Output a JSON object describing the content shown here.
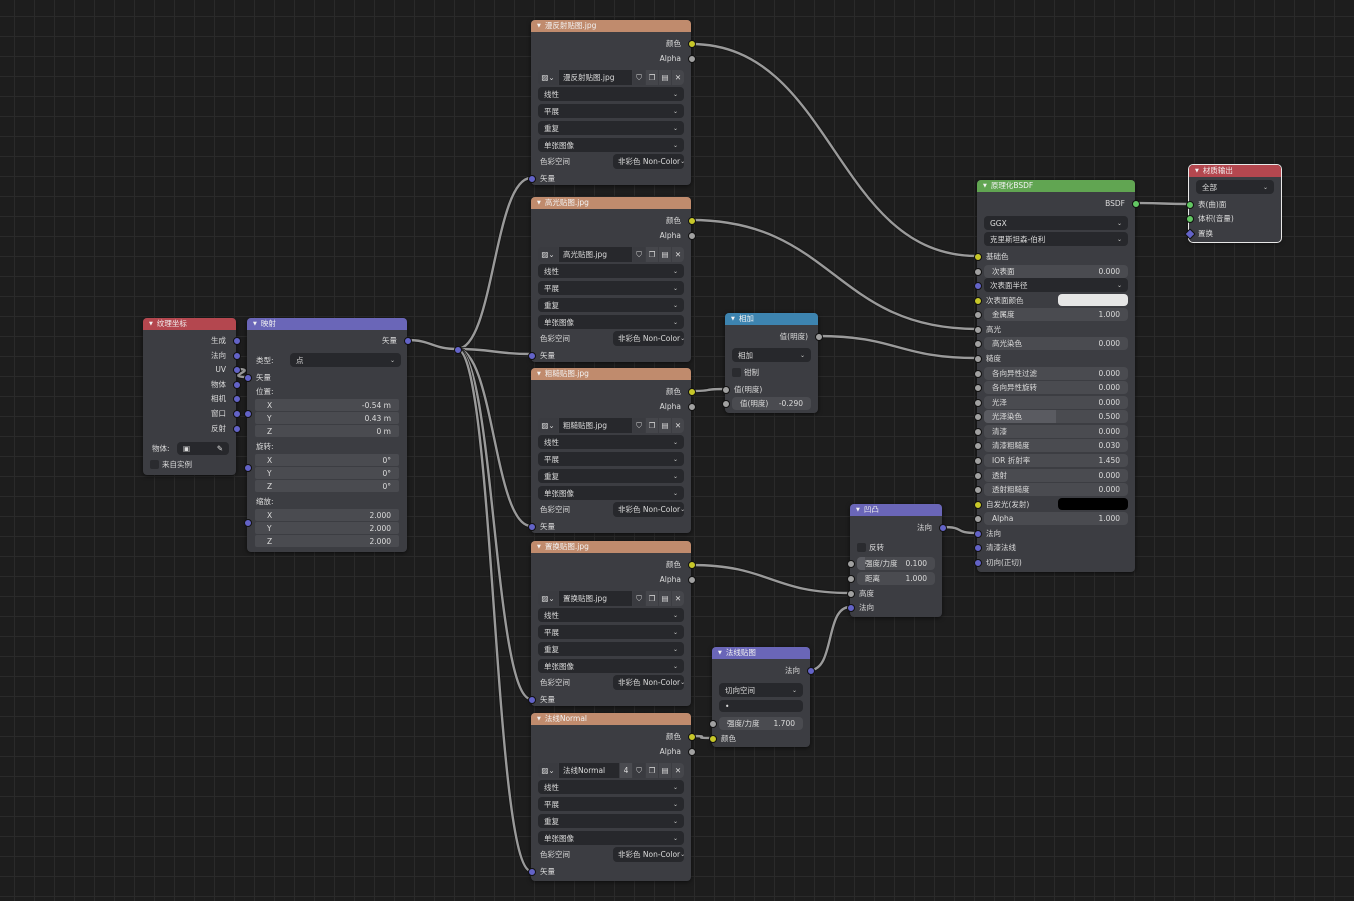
{
  "colors": {
    "socket_gray": "#a1a1a1",
    "socket_yellow": "#c7c729",
    "socket_blue": "#6363c7",
    "socket_green": "#63c763",
    "header_image": "#c08b6d",
    "header_input": "#b4474f",
    "header_vector": "#6a66b8",
    "header_converter": "#3d84b0",
    "header_shader": "#61a552",
    "header_output": "#b4474f",
    "wire": "#9a9a9a"
  },
  "nodes": {
    "texcoord": {
      "title": "纹理坐标",
      "rows": [
        {
          "k": "out",
          "label": "生成",
          "s": "blue"
        },
        {
          "k": "out",
          "label": "法向",
          "s": "blue"
        },
        {
          "k": "out",
          "label": "UV",
          "s": "blue"
        },
        {
          "k": "out",
          "label": "物体",
          "s": "blue"
        },
        {
          "k": "out",
          "label": "相机",
          "s": "blue"
        },
        {
          "k": "out",
          "label": "窗口",
          "s": "blue"
        },
        {
          "k": "out",
          "label": "反射",
          "s": "blue"
        },
        {
          "k": "object",
          "label": "物体:",
          "icon": "object-icon"
        },
        {
          "k": "check",
          "label": "来自实例",
          "checked": false
        }
      ]
    },
    "mapping": {
      "title": "映射",
      "rows": [
        {
          "k": "out",
          "label": "矢量",
          "s": "blue"
        },
        {
          "k": "prop",
          "label": "类型:",
          "value": "点"
        },
        {
          "k": "in",
          "label": "矢量",
          "s": "blue"
        },
        {
          "k": "lbl",
          "label": "位置:"
        },
        {
          "k": "vec",
          "label": "X",
          "value": "-0.54 m"
        },
        {
          "k": "vec",
          "label": "Y",
          "value": "0.43 m"
        },
        {
          "k": "vec",
          "label": "Z",
          "value": "0 m"
        },
        {
          "k": "lbl",
          "label": "旋转:"
        },
        {
          "k": "vec",
          "label": "X",
          "value": "0°"
        },
        {
          "k": "vec",
          "label": "Y",
          "value": "0°"
        },
        {
          "k": "vec",
          "label": "Z",
          "value": "0°"
        },
        {
          "k": "lbl",
          "label": "缩放:"
        },
        {
          "k": "vec",
          "label": "X",
          "value": "2.000"
        },
        {
          "k": "vec",
          "label": "Y",
          "value": "2.000"
        },
        {
          "k": "vec",
          "label": "Z",
          "value": "2.000"
        }
      ]
    },
    "img_diffuse": {
      "title": "漫反射贴图.jpg",
      "rows": [
        {
          "k": "out",
          "label": "颜色",
          "s": "yellow"
        },
        {
          "k": "out",
          "label": "Alpha",
          "s": "gray"
        },
        {
          "k": "img",
          "value": "漫反射贴图.jpg"
        },
        {
          "k": "dd",
          "value": "线性"
        },
        {
          "k": "dd",
          "value": "平展"
        },
        {
          "k": "dd",
          "value": "重复"
        },
        {
          "k": "dd",
          "value": "单张图像"
        },
        {
          "k": "cs",
          "label": "色彩空间",
          "value": "非彩色 Non-Color"
        },
        {
          "k": "in",
          "label": "矢量",
          "s": "blue"
        }
      ]
    },
    "img_specular": {
      "title": "高光贴图.jpg",
      "rows": [
        {
          "k": "out",
          "label": "颜色",
          "s": "yellow"
        },
        {
          "k": "out",
          "label": "Alpha",
          "s": "gray"
        },
        {
          "k": "img",
          "value": "高光贴图.jpg"
        },
        {
          "k": "dd",
          "value": "线性"
        },
        {
          "k": "dd",
          "value": "平展"
        },
        {
          "k": "dd",
          "value": "重复"
        },
        {
          "k": "dd",
          "value": "单张图像"
        },
        {
          "k": "cs",
          "label": "色彩空间",
          "value": "非彩色 Non-Color"
        },
        {
          "k": "in",
          "label": "矢量",
          "s": "blue"
        }
      ]
    },
    "img_roughness": {
      "title": "粗糙贴图.jpg",
      "rows": [
        {
          "k": "out",
          "label": "颜色",
          "s": "yellow"
        },
        {
          "k": "out",
          "label": "Alpha",
          "s": "gray"
        },
        {
          "k": "img",
          "value": "粗糙贴图.jpg"
        },
        {
          "k": "dd",
          "value": "线性"
        },
        {
          "k": "dd",
          "value": "平展"
        },
        {
          "k": "dd",
          "value": "重复"
        },
        {
          "k": "dd",
          "value": "单张图像"
        },
        {
          "k": "cs",
          "label": "色彩空间",
          "value": "非彩色 Non-Color"
        },
        {
          "k": "in",
          "label": "矢量",
          "s": "blue"
        }
      ]
    },
    "img_displacement": {
      "title": "置换贴图.jpg",
      "rows": [
        {
          "k": "out",
          "label": "颜色",
          "s": "yellow"
        },
        {
          "k": "out",
          "label": "Alpha",
          "s": "gray"
        },
        {
          "k": "img",
          "value": "置换贴图.jpg"
        },
        {
          "k": "dd",
          "value": "线性"
        },
        {
          "k": "dd",
          "value": "平展"
        },
        {
          "k": "dd",
          "value": "重复"
        },
        {
          "k": "dd",
          "value": "单张图像"
        },
        {
          "k": "cs",
          "label": "色彩空间",
          "value": "非彩色 Non-Color"
        },
        {
          "k": "in",
          "label": "矢量",
          "s": "blue"
        }
      ]
    },
    "img_normal": {
      "title": "法线Normal",
      "rows": [
        {
          "k": "out",
          "label": "颜色",
          "s": "yellow"
        },
        {
          "k": "out",
          "label": "Alpha",
          "s": "gray"
        },
        {
          "k": "img",
          "value": "法线Normal",
          "users": "4"
        },
        {
          "k": "dd",
          "value": "线性"
        },
        {
          "k": "dd",
          "value": "平展"
        },
        {
          "k": "dd",
          "value": "重复"
        },
        {
          "k": "dd",
          "value": "单张图像"
        },
        {
          "k": "cs",
          "label": "色彩空间",
          "value": "非彩色 Non-Color"
        },
        {
          "k": "in",
          "label": "矢量",
          "s": "blue"
        }
      ]
    },
    "math_add": {
      "title": "相加",
      "rows": [
        {
          "k": "out",
          "label": "值(明度)",
          "s": "gray"
        },
        {
          "k": "dd",
          "value": "相加"
        },
        {
          "k": "check",
          "label": "钳制",
          "checked": false
        },
        {
          "k": "in",
          "label": "值(明度)",
          "s": "gray"
        },
        {
          "k": "fld",
          "label": "值(明度)",
          "value": "-0.290",
          "s": "gray"
        }
      ]
    },
    "bump": {
      "title": "凹凸",
      "rows": [
        {
          "k": "out",
          "label": "法向",
          "s": "blue"
        },
        {
          "k": "check",
          "label": "反转",
          "checked": false
        },
        {
          "k": "fld",
          "label": "强度/力度",
          "value": "0.100",
          "s": "gray",
          "fill": 0.1
        },
        {
          "k": "fld",
          "label": "距离",
          "value": "1.000",
          "s": "gray"
        },
        {
          "k": "in",
          "label": "高度",
          "s": "gray"
        },
        {
          "k": "in",
          "label": "法向",
          "s": "blue"
        }
      ]
    },
    "normal_map": {
      "title": "法线贴图",
      "rows": [
        {
          "k": "out",
          "label": "法向",
          "s": "blue"
        },
        {
          "k": "dd",
          "value": "切向空间"
        },
        {
          "k": "blank",
          "value": "•"
        },
        {
          "k": "fld",
          "label": "强度/力度",
          "value": "1.700",
          "s": "gray"
        },
        {
          "k": "in",
          "label": "颜色",
          "s": "yellow"
        }
      ]
    },
    "bsdf": {
      "title": "原理化BSDF",
      "rows": [
        {
          "k": "out",
          "label": "BSDF",
          "s": "green"
        },
        {
          "k": "dd",
          "value": "GGX"
        },
        {
          "k": "dd",
          "value": "克里斯坦森-伯利"
        },
        {
          "k": "in",
          "label": "基础色",
          "s": "yellow"
        },
        {
          "k": "fld",
          "label": "次表面",
          "value": "0.000",
          "s": "gray"
        },
        {
          "k": "dd",
          "value": "次表面半径",
          "s": "blue"
        },
        {
          "k": "color",
          "label": "次表面颜色",
          "value": "#e6e6e6",
          "s": "yellow"
        },
        {
          "k": "fld",
          "label": "金属度",
          "value": "1.000",
          "s": "gray"
        },
        {
          "k": "in",
          "label": "高光",
          "s": "gray"
        },
        {
          "k": "fld",
          "label": "高光染色",
          "value": "0.000",
          "s": "gray"
        },
        {
          "k": "in",
          "label": "糙度",
          "s": "gray"
        },
        {
          "k": "fld",
          "label": "各向异性过滤",
          "value": "0.000",
          "s": "gray"
        },
        {
          "k": "fld",
          "label": "各向异性旋转",
          "value": "0.000",
          "s": "gray"
        },
        {
          "k": "fld",
          "label": "光泽",
          "value": "0.000",
          "s": "gray"
        },
        {
          "k": "fld",
          "label": "光泽染色",
          "value": "0.500",
          "s": "gray",
          "fill": 0.5
        },
        {
          "k": "fld",
          "label": "清漆",
          "value": "0.000",
          "s": "gray"
        },
        {
          "k": "fld",
          "label": "清漆粗糙度",
          "value": "0.030",
          "s": "gray"
        },
        {
          "k": "fld",
          "label": "IOR 折射率",
          "value": "1.450",
          "s": "gray"
        },
        {
          "k": "fld",
          "label": "透射",
          "value": "0.000",
          "s": "gray"
        },
        {
          "k": "fld",
          "label": "透射粗糙度",
          "value": "0.000",
          "s": "gray"
        },
        {
          "k": "color",
          "label": "自发光(发射)",
          "value": "#000000",
          "s": "yellow"
        },
        {
          "k": "fld",
          "label": "Alpha",
          "value": "1.000",
          "s": "gray"
        },
        {
          "k": "in",
          "label": "法向",
          "s": "blue"
        },
        {
          "k": "in",
          "label": "清漆法线",
          "s": "blue"
        },
        {
          "k": "in",
          "label": "切向(正切)",
          "s": "blue"
        }
      ]
    },
    "output": {
      "title": "材质输出",
      "rows": [
        {
          "k": "dd",
          "value": "全部"
        },
        {
          "k": "in",
          "label": "表(曲)面",
          "s": "green"
        },
        {
          "k": "in",
          "label": "体积(音量)",
          "s": "green"
        },
        {
          "k": "in",
          "label": "置换",
          "s": "blue",
          "diamond": true
        }
      ]
    }
  }
}
